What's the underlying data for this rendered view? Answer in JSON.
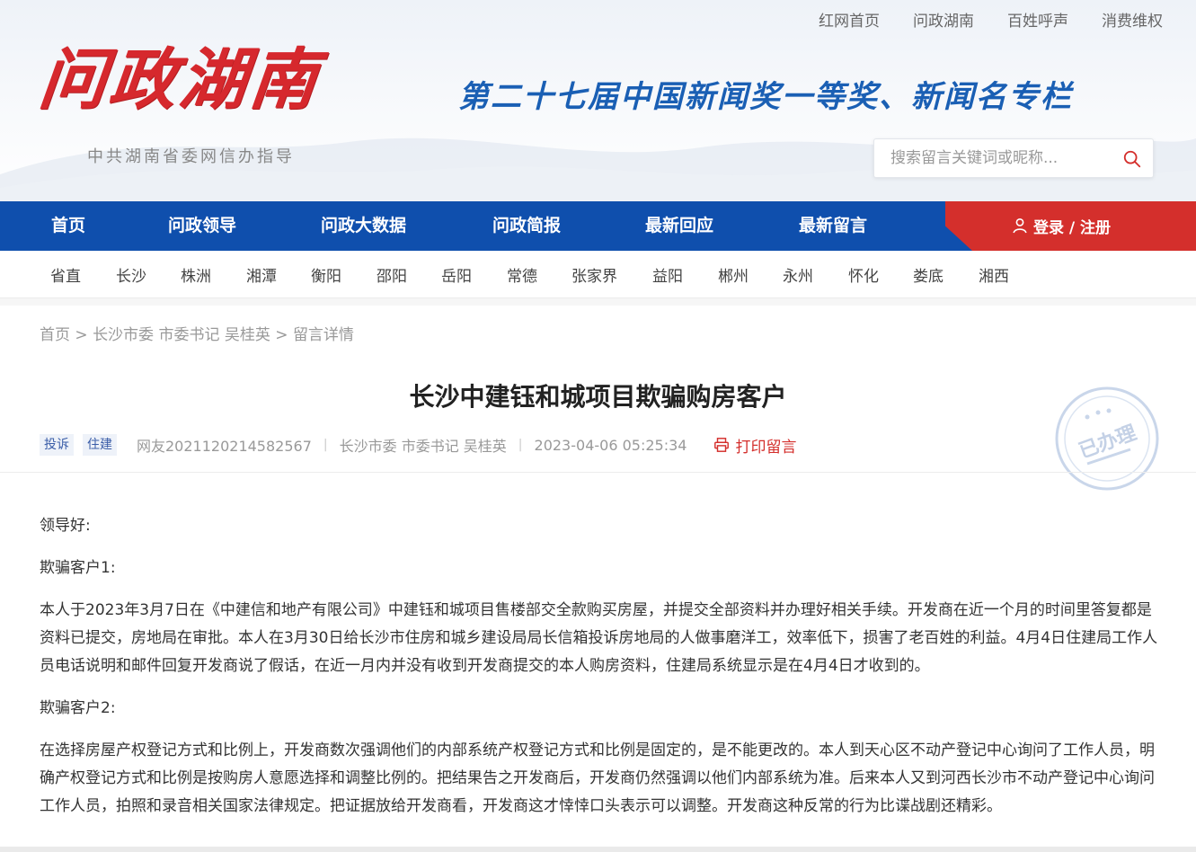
{
  "header": {
    "top_links": [
      "红网首页",
      "问政湖南",
      "百姓呼声",
      "消费维权"
    ],
    "logo_title": "问政湖南",
    "logo_subtitle": "中共湖南省委网信办指导",
    "award_banner": "第二十七届中国新闻奖一等奖、新闻名专栏",
    "search": {
      "placeholder": "搜索留言关键词或昵称...",
      "icon": "search-icon"
    }
  },
  "main_nav": {
    "items": [
      "首页",
      "问政领导",
      "问政大数据",
      "问政简报",
      "最新回应",
      "最新留言"
    ],
    "login_label": "登录 / 注册",
    "colors": {
      "nav_blue": "#0f4fad",
      "login_red": "#d42f2c"
    }
  },
  "city_nav": {
    "items": [
      "省直",
      "长沙",
      "株洲",
      "湘潭",
      "衡阳",
      "邵阳",
      "岳阳",
      "常德",
      "张家界",
      "益阳",
      "郴州",
      "永州",
      "怀化",
      "娄底",
      "湘西"
    ]
  },
  "breadcrumb": {
    "home": "首页",
    "sep1": ">",
    "leader": "长沙市委 市委书记 吴桂英",
    "sep2": ">",
    "current": "留言详情"
  },
  "article": {
    "title": "长沙中建钰和城项目欺骗购房客户",
    "tags": [
      "投诉",
      "住建"
    ],
    "author": "网友2021120214582567",
    "recipient": "长沙市委 市委书记 吴桂英",
    "datetime": "2023-04-06 05:25:34",
    "print_label": "打印留言",
    "stamp_label": "已办理",
    "paragraphs": [
      "领导好:",
      "欺骗客户1:",
      "本人于2023年3月7日在《中建信和地产有限公司》中建钰和城项目售楼部交全款购买房屋，并提交全部资料并办理好相关手续。开发商在近一个月的时间里答复都是资料已提交，房地局在审批。本人在3月30日给长沙市住房和城乡建设局局长信箱投诉房地局的人做事磨洋工，效率低下，损害了老百姓的利益。4月4日住建局工作人员电话说明和邮件回复开发商说了假话，在近一月内并没有收到开发商提交的本人购房资料，住建局系统显示是在4月4日才收到的。",
      "欺骗客户2:",
      "在选择房屋产权登记方式和比例上，开发商数次强调他们的内部系统产权登记方式和比例是固定的，是不能更改的。本人到天心区不动产登记中心询问了工作人员，明确产权登记方式和比例是按购房人意愿选择和调整比例的。把结果告之开发商后，开发商仍然强调以他们内部系统为准。后来本人又到河西长沙市不动产登记中心询问工作人员，拍照和录音相关国家法律规定。把证据放给开发商看，开发商这才悻悻口头表示可以调整。开发商这种反常的行为比谍战剧还精彩。"
    ]
  }
}
